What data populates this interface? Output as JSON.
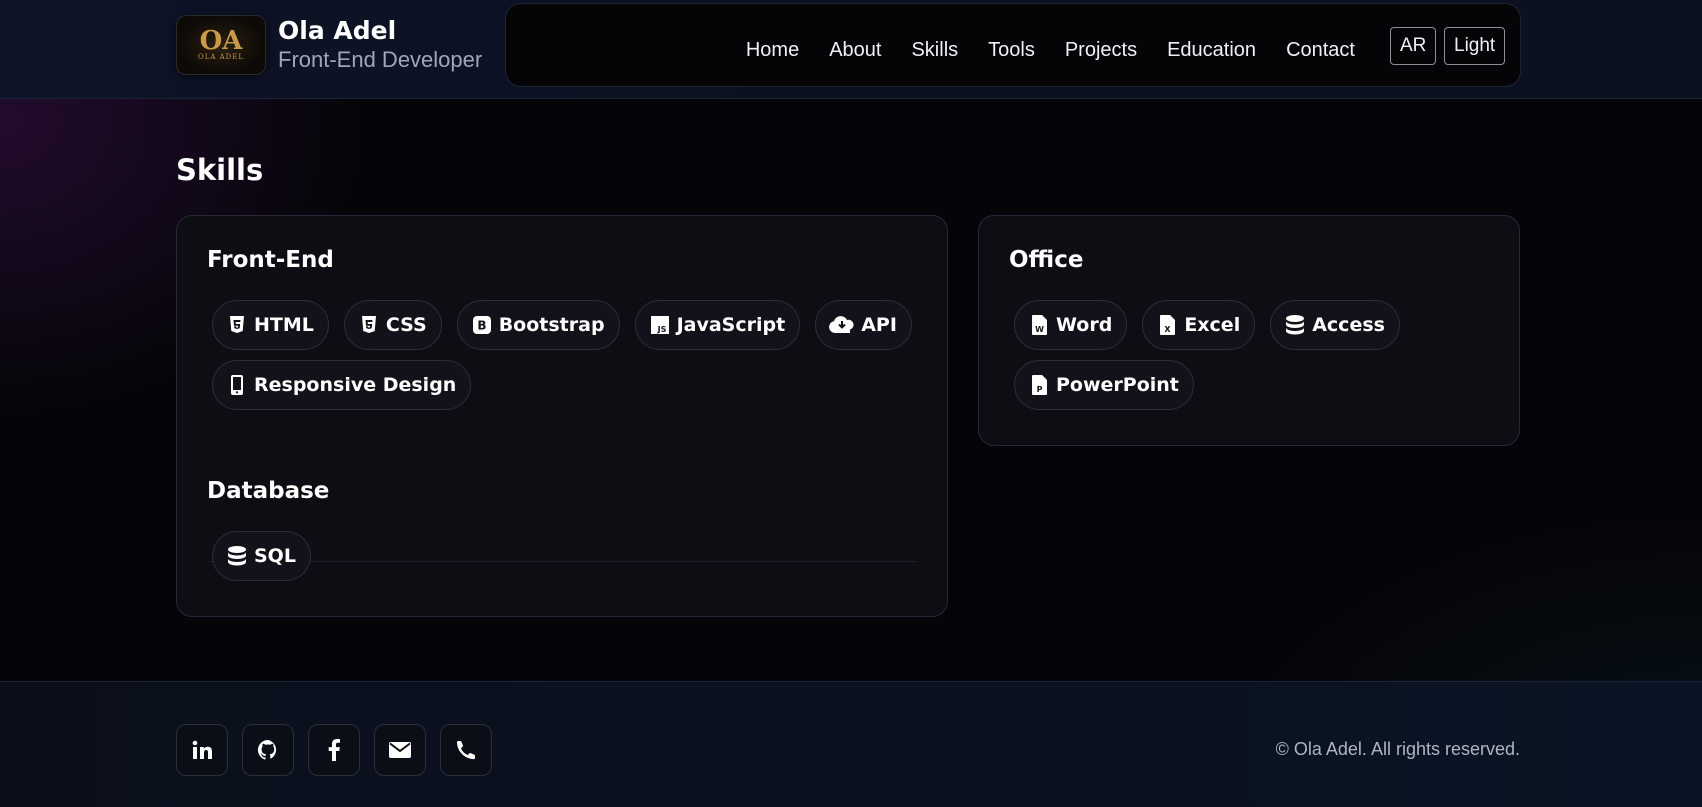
{
  "brand": {
    "logo_mark": "OA",
    "logo_sub": "OLA ADEL",
    "name": "Ola Adel",
    "role": "Front-End Developer"
  },
  "nav": {
    "items": [
      "Home",
      "About",
      "Skills",
      "Tools",
      "Projects",
      "Education",
      "Contact"
    ],
    "lang_button": "AR",
    "theme_button": "Light"
  },
  "skills": {
    "title": "Skills",
    "frontend": {
      "title": "Front-End",
      "items": [
        {
          "label": "HTML",
          "icon": "html5-icon"
        },
        {
          "label": "CSS",
          "icon": "css3-icon"
        },
        {
          "label": "Bootstrap",
          "icon": "bootstrap-icon"
        },
        {
          "label": "JavaScript",
          "icon": "javascript-icon"
        },
        {
          "label": "API",
          "icon": "cloud-download-icon"
        },
        {
          "label": "Responsive Design",
          "icon": "mobile-icon"
        }
      ]
    },
    "database": {
      "title": "Database",
      "items": [
        {
          "label": "SQL",
          "icon": "database-icon"
        }
      ]
    },
    "office": {
      "title": "Office",
      "items": [
        {
          "label": "Word",
          "icon": "word-file-icon"
        },
        {
          "label": "Excel",
          "icon": "excel-file-icon"
        },
        {
          "label": "Access",
          "icon": "database-icon"
        },
        {
          "label": "PowerPoint",
          "icon": "powerpoint-file-icon"
        }
      ]
    }
  },
  "footer": {
    "socials": [
      "linkedin-icon",
      "github-icon",
      "facebook-icon",
      "email-icon",
      "phone-icon"
    ],
    "copyright": "© Ola Adel. All rights reserved."
  }
}
